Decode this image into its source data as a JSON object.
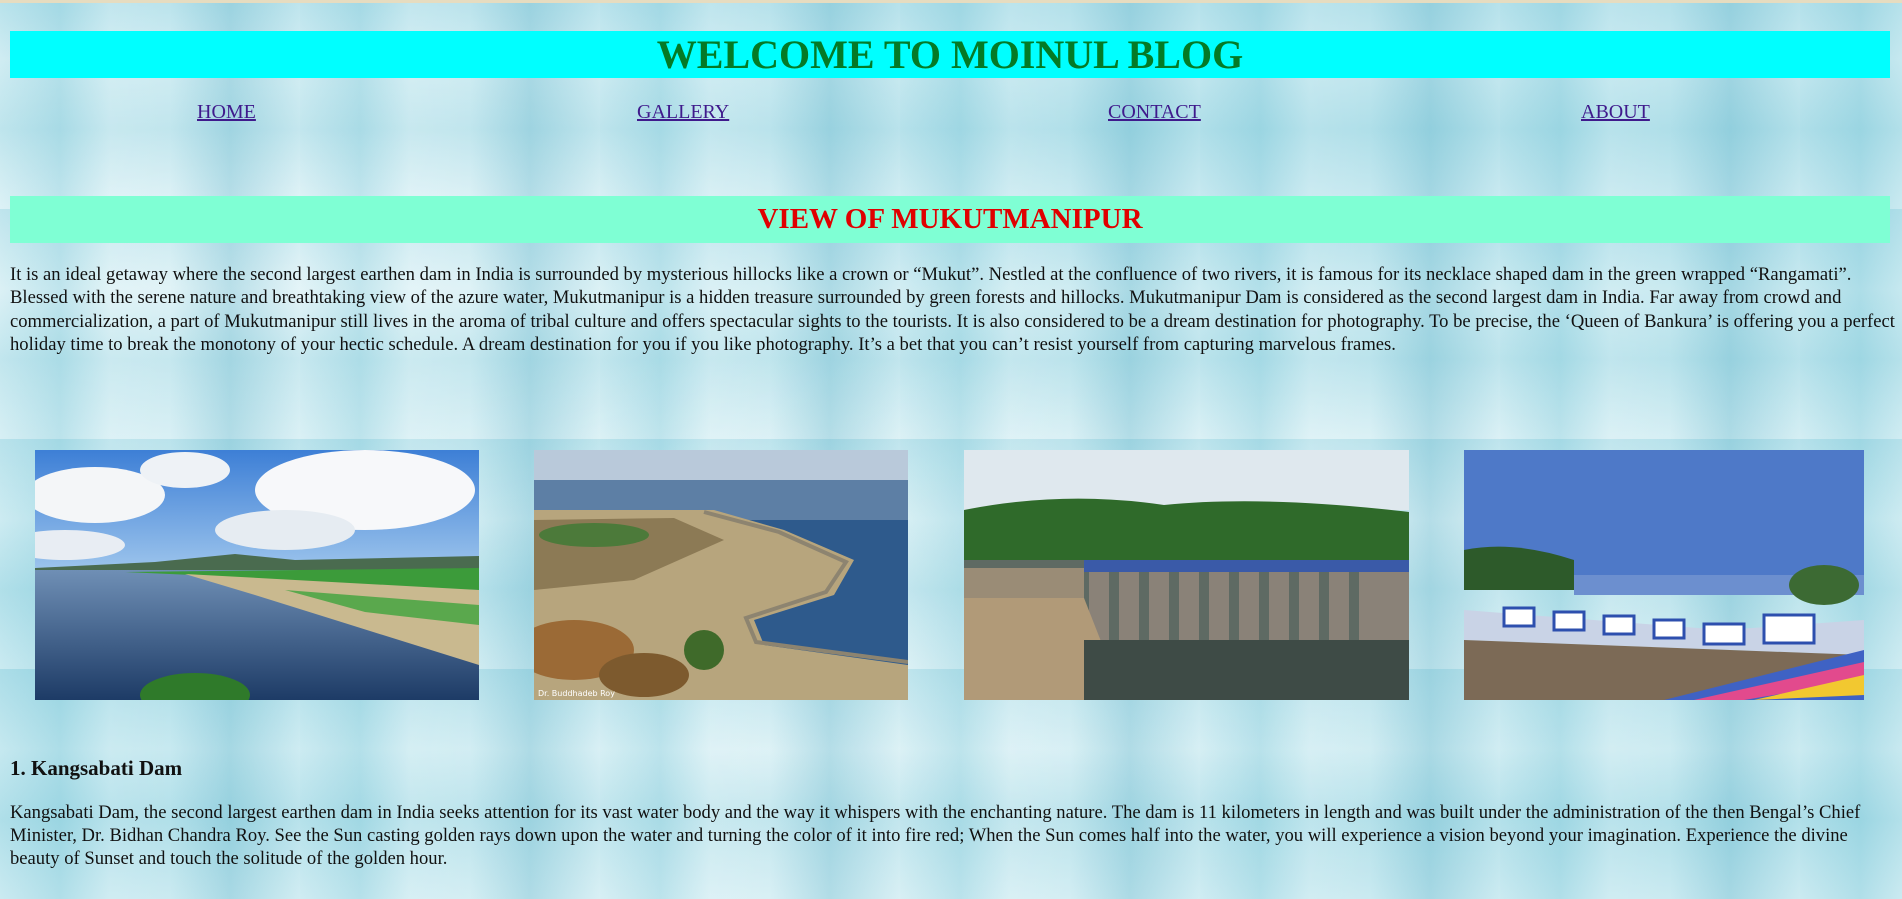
{
  "header": {
    "title": "WELCOME TO MOINUL BLOG"
  },
  "nav": {
    "items": [
      {
        "label": "HOME"
      },
      {
        "label": "GALLERY"
      },
      {
        "label": "CONTACT"
      },
      {
        "label": "ABOUT"
      }
    ]
  },
  "section": {
    "title": "VIEW OF MUKUTMANIPUR",
    "intro": "It is an ideal getaway where the second largest earthen dam in India is surrounded by mysterious hillocks like a crown or “Mukut”. Nestled at the confluence of two rivers, it is famous for its necklace shaped dam in the green wrapped “Rangamati”. Blessed with the serene nature and breathtaking view of the azure water, Mukutmanipur is a hidden treasure surrounded by green forests and hillocks. Mukutmanipur Dam is considered as the second largest dam in India. Far away from crowd and commercialization, a part of Mukutmanipur still lives in the aroma of tribal culture and offers spectacular sights to the tourists. It is also considered to be a dream destination for photography. To be precise, the ‘Queen of Bankura’ is offering you a perfect holiday time to break the monotony of your hectic schedule. A dream destination for you if you like photography. It’s a bet that you can’t resist yourself from capturing marvelous frames."
  },
  "gallery": {
    "photos": [
      {
        "subject": "lake-with-clouds"
      },
      {
        "subject": "curved-dam-embankment",
        "credit": "Dr. Buddhadeb Roy"
      },
      {
        "subject": "dam-sluice-gates"
      },
      {
        "subject": "dam-bridge-with-buildings"
      }
    ]
  },
  "article": {
    "heading": "1. Kangsabati Dam",
    "body": "Kangsabati Dam, the second largest earthen dam in India seeks attention for its vast water body and the way it whispers with the enchanting nature. The dam is 11 kilometers in length and was built under the administration of the then Bengal’s Chief Minister, Dr. Bidhan Chandra Roy. See the Sun casting golden rays down upon the water and turning the color of it into fire red; When the Sun comes half into the water, you will experience a vision beyond your imagination. Experience the divine beauty of Sunset and touch the solitude of the golden hour."
  },
  "colors": {
    "title_bg": "#00ffff",
    "title_text": "#047a26",
    "section_bg": "#7fffd4",
    "section_text": "#e00000",
    "link": "#3f1a8c"
  }
}
